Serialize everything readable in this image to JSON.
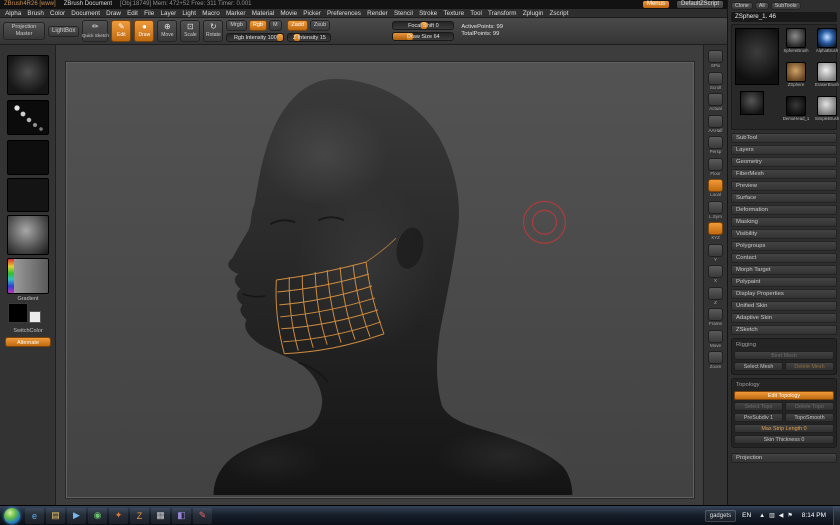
{
  "colors": {
    "accent_orange": "#e8963a",
    "cursor_red": "#b23b3b",
    "topology_orange": "#df9540"
  },
  "title_bar": {
    "app_name": "ZBrush4R26 [www]",
    "doc_name": "ZBrush Document",
    "stats": "[Obj:18749]  Mem: 472+52  Free: 311  Timer: 0.001",
    "menus_button": "Menus",
    "zscript_button": "DefaultZScript"
  },
  "menu_bar": {
    "items": [
      "Alpha",
      "Brush",
      "Color",
      "Document",
      "Draw",
      "Edit",
      "File",
      "Layer",
      "Light",
      "Macro",
      "Marker",
      "Material",
      "Movie",
      "Picker",
      "Preferences",
      "Render",
      "Stencil",
      "Stroke",
      "Texture",
      "Tool",
      "Transform",
      "Zplugin",
      "Zscript"
    ]
  },
  "icons": {
    "edit": "✎",
    "quick_sketch": "✏",
    "draw": "●",
    "move": "⊕",
    "scale": "⊡",
    "rotate": "↻"
  },
  "top_shelf": {
    "projection_master": "Projection Master",
    "lightbox": "LightBox",
    "quick_sketch": "Quick Sketch",
    "edit": "Edit",
    "draw": "Draw",
    "move": "Move",
    "scale": "Scale",
    "rotate": "Rotate",
    "mrgb": "Mrgb",
    "rgb": "Rgb",
    "m": "M",
    "zadd": "Zadd",
    "zsub": "Zsub",
    "rgb_intensity": "Rgb Intensity 100",
    "z_intensity": "Z Intensity 15",
    "focal_shift": "Focal Shift 0",
    "draw_size": "Draw Size 64",
    "active_points": "ActivePoints: 99",
    "total_points": "TotalPoints: 99"
  },
  "left_tray": {
    "gradient_label": "Gradient",
    "switch_label": "SwitchColor",
    "alternate_button": "Alternate"
  },
  "right_shelf": {
    "items": [
      "SPix",
      "Scroll",
      "Actual",
      "AAHalf",
      "Persp",
      "Floor",
      "Local",
      "L.Sym",
      "XYZ",
      "Y",
      "X",
      "Z",
      "Frame",
      "Move",
      "Zoom"
    ]
  },
  "tool_panel": {
    "clone": "Clone",
    "all": "All",
    "subtools": "SubTools",
    "current_tool": "ZSphere_1. 46",
    "recent_tools": [
      "SphereBrush",
      "AlphaBrush",
      "ZSphere",
      "EraserBrush",
      "DemoHead_1",
      "SimpleBrush"
    ],
    "sections": [
      "SubTool",
      "Layers",
      "Geometry",
      "FiberMesh",
      "Preview",
      "Surface",
      "Deformation",
      "Masking",
      "Visibility",
      "Polygroups",
      "Contact",
      "Morph Target",
      "Polypaint",
      "Display Properties",
      "Unified Skin",
      "Adaptive Skin",
      "ZSketch"
    ],
    "rigging": {
      "header": "Rigging",
      "bind_mesh": "Bind Mesh",
      "select_mesh": "Select Mesh",
      "delete_mesh": "Delete Mesh"
    },
    "topology": {
      "header": "Topology",
      "edit": "Edit Topology",
      "select": "Select Topo",
      "delete": "Delete Topo",
      "presubdiv": "PreSubdiv 1",
      "toposmooth": "TopoSmooth",
      "max_strip": "Max Strip Length 0",
      "skin_thickness": "Skin Thickness 0"
    },
    "projection": "Projection"
  },
  "taskbar": {
    "gadgets": "gadgets",
    "language": "EN",
    "time": "8:14 PM",
    "icons": [
      {
        "name": "internet-explorer",
        "glyph": "e"
      },
      {
        "name": "folder-explorer",
        "glyph": "▤"
      },
      {
        "name": "media-player",
        "glyph": "▶"
      },
      {
        "name": "messenger",
        "glyph": "◉"
      },
      {
        "name": "photo-viewer",
        "glyph": "✦"
      },
      {
        "name": "zbrush",
        "glyph": "Z"
      },
      {
        "name": "notepad",
        "glyph": "▦"
      },
      {
        "name": "settings",
        "glyph": "◧"
      },
      {
        "name": "paint",
        "glyph": "✎"
      }
    ],
    "tray_icons": [
      "▲",
      "▥",
      "◀",
      "⚑"
    ]
  }
}
